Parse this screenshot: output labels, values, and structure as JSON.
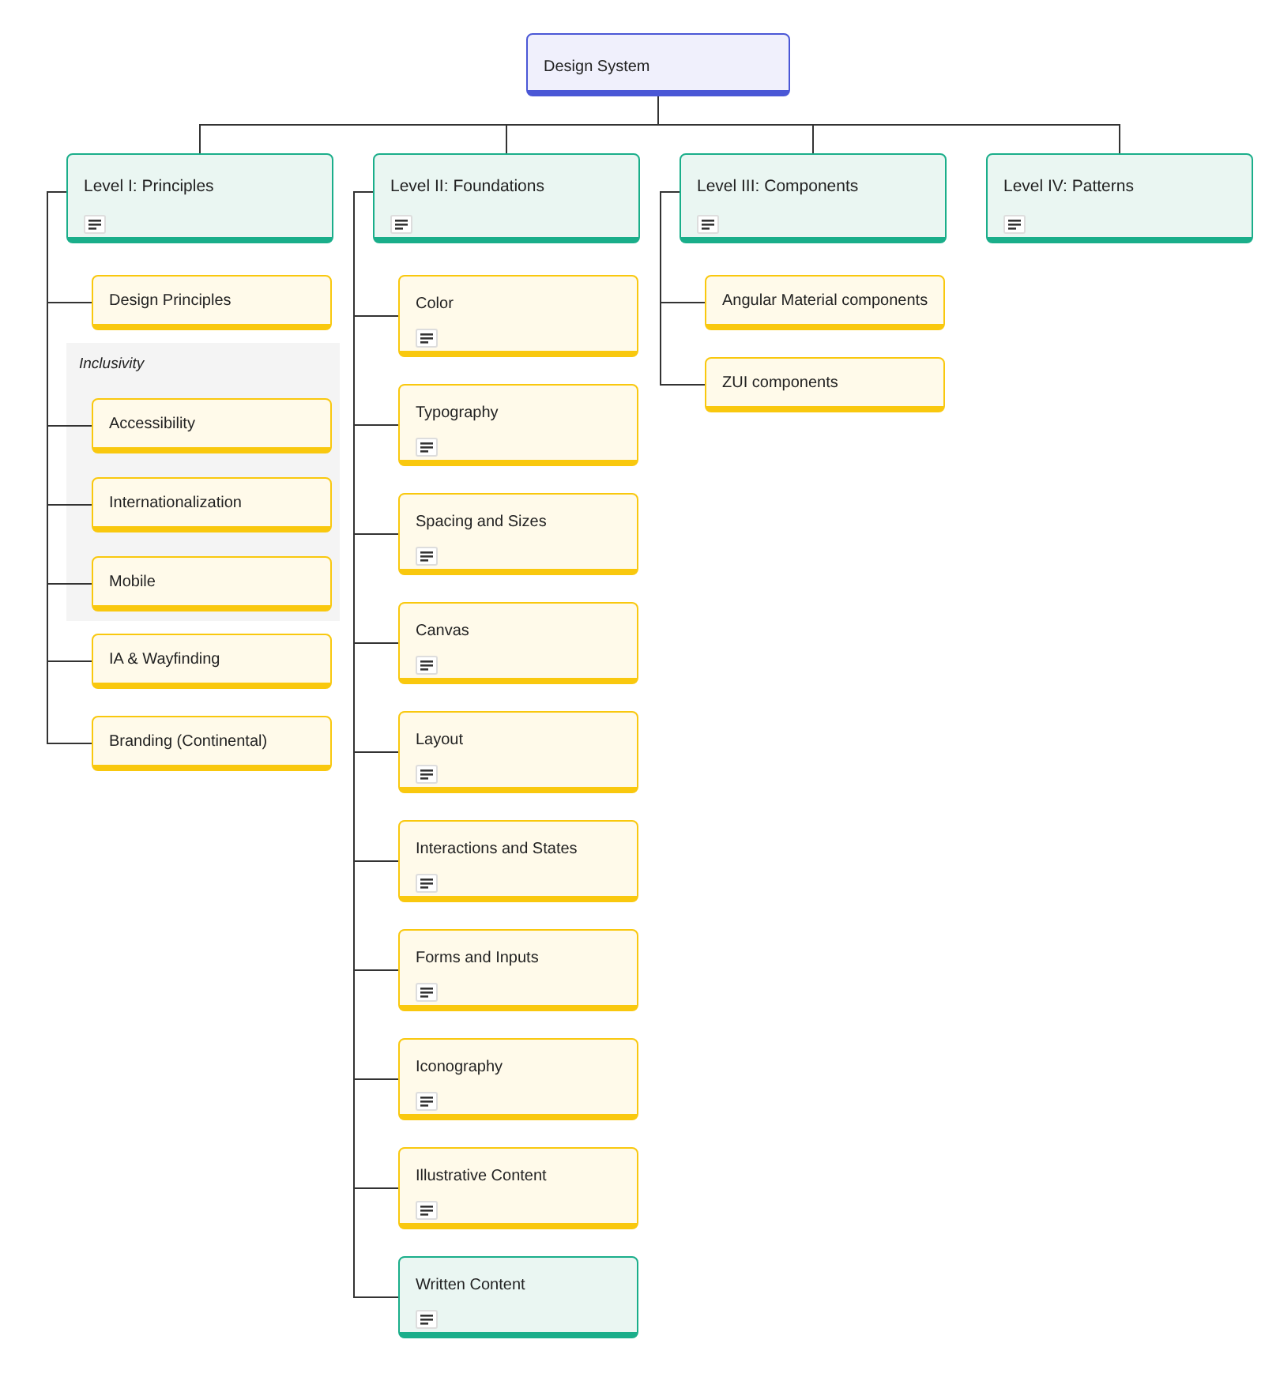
{
  "root": {
    "title": "Design System",
    "color": "#4a57d6"
  },
  "branches": [
    {
      "title": "Level I: Principles",
      "color": "#1aae8a",
      "notes": true,
      "children": [
        {
          "kind": "node",
          "title": "Design Principles",
          "color": "#f9c80e",
          "notes": false
        },
        {
          "kind": "group",
          "label": "Inclusivity",
          "children": [
            {
              "kind": "node",
              "title": "Accessibility",
              "color": "#f9c80e",
              "notes": false
            },
            {
              "kind": "node",
              "title": "Internationalization",
              "color": "#f9c80e",
              "notes": false
            },
            {
              "kind": "node",
              "title": "Mobile",
              "color": "#f9c80e",
              "notes": false
            }
          ]
        },
        {
          "kind": "node",
          "title": "IA & Wayfinding",
          "color": "#f9c80e",
          "notes": false
        },
        {
          "kind": "node",
          "title": "Branding (Continental)",
          "color": "#f9c80e",
          "notes": false
        }
      ]
    },
    {
      "title": "Level II: Foundations",
      "color": "#1aae8a",
      "notes": true,
      "children": [
        {
          "kind": "node",
          "title": "Color",
          "color": "#f9c80e",
          "notes": true
        },
        {
          "kind": "node",
          "title": "Typography",
          "color": "#f9c80e",
          "notes": true
        },
        {
          "kind": "node",
          "title": "Spacing and Sizes",
          "color": "#f9c80e",
          "notes": true
        },
        {
          "kind": "node",
          "title": "Canvas",
          "color": "#f9c80e",
          "notes": true
        },
        {
          "kind": "node",
          "title": "Layout",
          "color": "#f9c80e",
          "notes": true
        },
        {
          "kind": "node",
          "title": "Interactions and States",
          "color": "#f9c80e",
          "notes": true
        },
        {
          "kind": "node",
          "title": "Forms and Inputs",
          "color": "#f9c80e",
          "notes": true
        },
        {
          "kind": "node",
          "title": "Iconography",
          "color": "#f9c80e",
          "notes": true
        },
        {
          "kind": "node",
          "title": "Illustrative Content",
          "color": "#f9c80e",
          "notes": true
        },
        {
          "kind": "node",
          "title": "Written Content",
          "color": "#1aae8a",
          "notes": true
        }
      ]
    },
    {
      "title": "Level III: Components",
      "color": "#1aae8a",
      "notes": true,
      "children": [
        {
          "kind": "node",
          "title": "Angular Material components",
          "color": "#f9c80e",
          "notes": false
        },
        {
          "kind": "node",
          "title": "ZUI components",
          "color": "#f9c80e",
          "notes": false
        }
      ]
    },
    {
      "title": "Level IV: Patterns",
      "color": "#1aae8a",
      "notes": true
    }
  ]
}
